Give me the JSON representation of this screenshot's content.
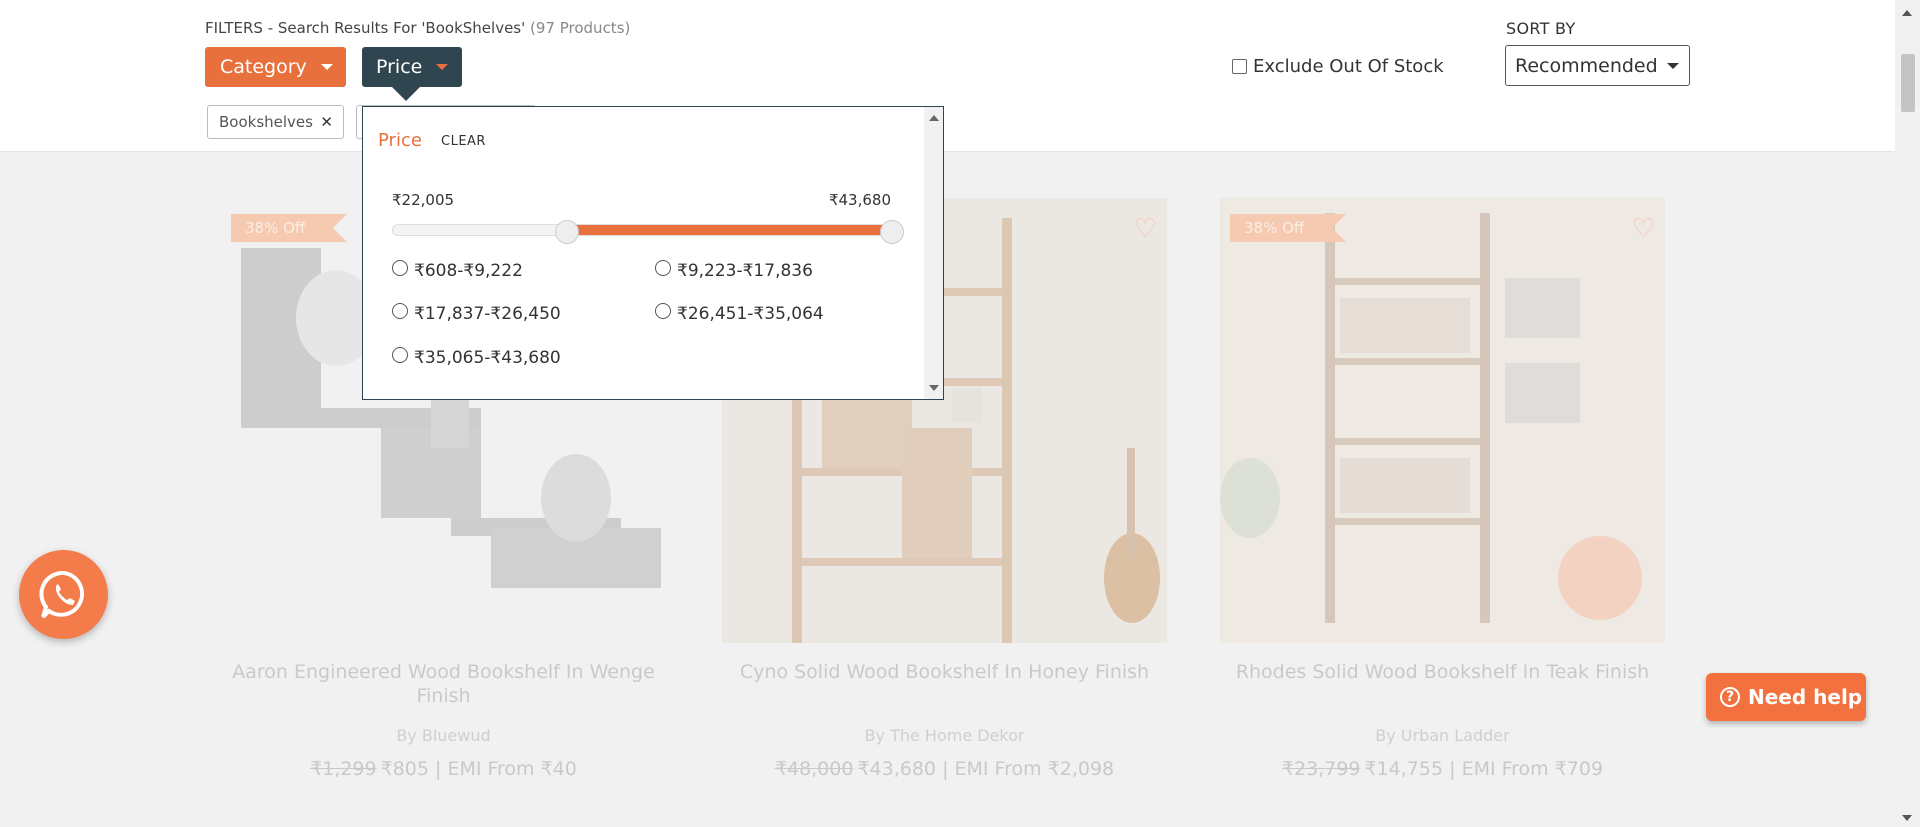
{
  "header": {
    "filters_label": "FILTERS - Search Results For 'BookShelves'",
    "product_count": "(97 Products)",
    "category_button": "Category",
    "price_button": "Price",
    "exclude_label": "Exclude Out Of Stock",
    "sort_label": "SORT BY",
    "sort_value": "Recommended"
  },
  "chips": [
    {
      "label": "Bookshelves",
      "remove": "✕"
    }
  ],
  "price_panel": {
    "title": "Price",
    "clear": "CLEAR",
    "min_label": "₹22,005",
    "max_label": "₹43,680",
    "range_low_fraction": 0.35,
    "range_high_fraction": 1.0,
    "options": [
      "₹608-₹9,222",
      "₹9,223-₹17,836",
      "₹17,837-₹26,450",
      "₹26,451-₹35,064",
      "₹35,065-₹43,680"
    ]
  },
  "products": [
    {
      "badge": "38% Off",
      "title": "Aaron Engineered Wood Bookshelf In Wenge Finish",
      "brand": "By Bluewud",
      "old_price": "₹1,299",
      "price": "₹805",
      "emi": "| EMI From ₹40"
    },
    {
      "badge": "",
      "title": "Cyno Solid Wood Bookshelf In Honey Finish",
      "brand": "By The Home Dekor",
      "old_price": "₹48,000",
      "price": "₹43,680",
      "emi": "| EMI From ₹2,098"
    },
    {
      "badge": "38% Off",
      "title": "Rhodes Solid Wood Bookshelf In Teak Finish",
      "brand": "By Urban Ladder",
      "old_price": "₹23,799",
      "price": "₹14,755",
      "emi": "| EMI From ₹709"
    }
  ],
  "widgets": {
    "help_label": "Need help",
    "help_icon": "?"
  },
  "icons": {
    "whatsapp": "whatsapp-icon",
    "heart": "heart-icon",
    "close": "close-icon",
    "caret": "chevron-down-icon"
  },
  "colors": {
    "accent": "#e8703d",
    "dark": "#2f4550"
  }
}
